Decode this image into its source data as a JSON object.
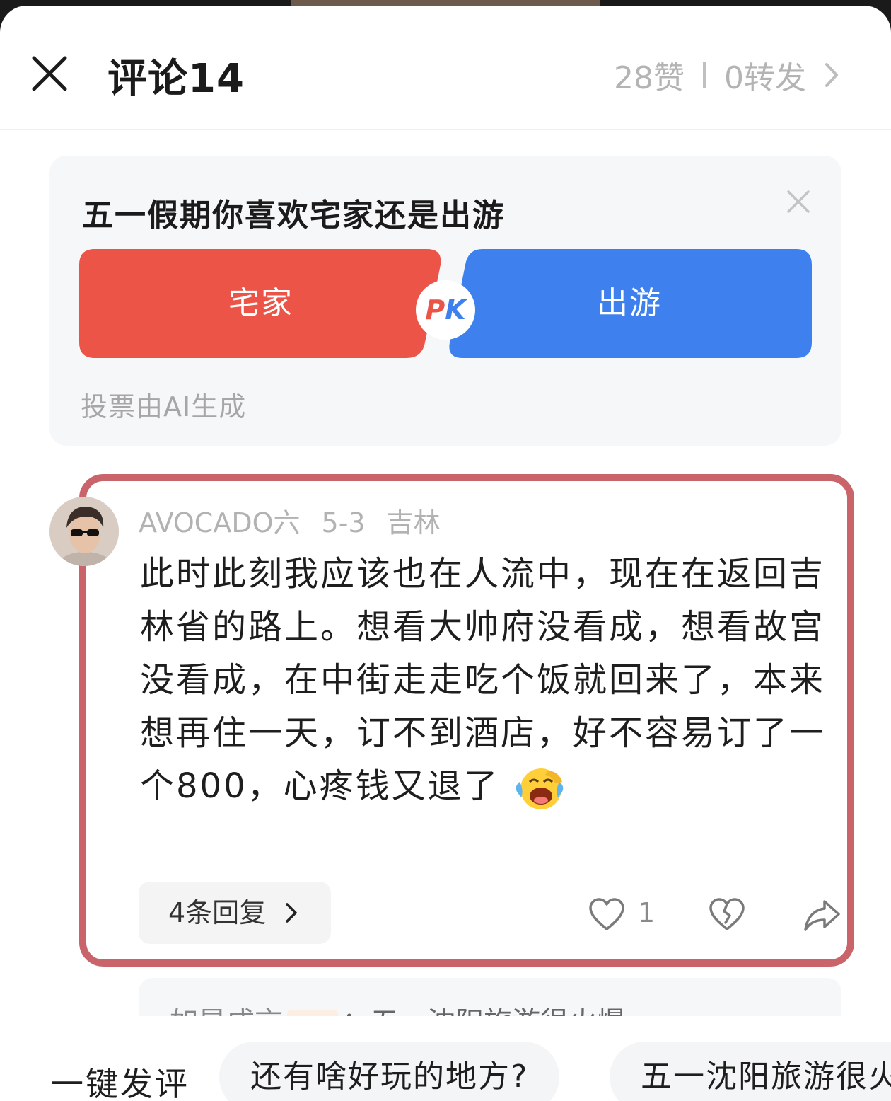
{
  "header": {
    "title": "评论14",
    "likes": "28赞",
    "reposts": "0转发"
  },
  "poll": {
    "question": "五一假期你喜欢宅家还是出游",
    "option_left": "宅家",
    "option_right": "出游",
    "pk_p": "P",
    "pk_k": "K",
    "note": "投票由AI生成",
    "colors": {
      "left": "#eb5446",
      "right": "#3d80ee"
    }
  },
  "comment": {
    "username": "AVOCADO六",
    "date": "5-3",
    "location": "吉林",
    "text": "此时此刻我应该也在人流中，现在在返回吉林省的路上。想看大帅府没看成，想看故宫没看成，在中街走走吃个饭就回来了，本来想再住一天，订不到酒店，好不容易订了一个800，心疼钱又退了",
    "emoji": "laughing-crying-emoji",
    "replies_label": "4条回复",
    "like_count": "1",
    "highlight_color": "#c8646a"
  },
  "reply_preview": {
    "name": "如是成言",
    "tag": "作者",
    "text": "：五一沈阳旅游很火爆"
  },
  "bottom": {
    "quick_label": "一键发评",
    "chips": [
      "还有啥好玩的地方?",
      "五一沈阳旅游很火"
    ]
  }
}
